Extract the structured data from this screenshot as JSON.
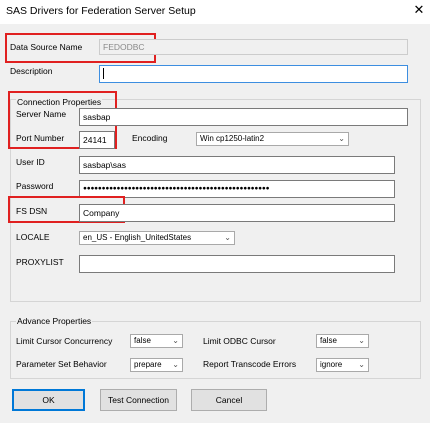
{
  "window": {
    "title": "SAS Drivers for Federation Server Setup",
    "close_glyph": "✕"
  },
  "datasource": {
    "label": "Data Source Name",
    "value": "FEDODBC"
  },
  "description": {
    "label": "Description",
    "value": ""
  },
  "connection": {
    "group_label": "Connection Properties",
    "server_name": {
      "label": "Server Name",
      "value": "sasbap"
    },
    "port_number": {
      "label": "Port Number",
      "value": "24141"
    },
    "encoding": {
      "label": "Encoding",
      "value": "Win cp1250-latin2"
    },
    "user_id": {
      "label": "User ID",
      "value": "sasbap\\sas"
    },
    "password": {
      "label": "Password",
      "value": "●●●●●●●●●●●●●●●●●●●●●●●●●●●●●●●●●●●●●●●●●●●●●●●●●●"
    },
    "fs_dsn": {
      "label": "FS DSN",
      "value": "Company"
    },
    "locale": {
      "label": "LOCALE",
      "value": "en_US - English_UnitedStates"
    },
    "proxylist": {
      "label": "PROXYLIST",
      "value": ""
    }
  },
  "advance": {
    "group_label": "Advance Properties",
    "limit_cursor_concurrency": {
      "label": "Limit Cursor Concurrency",
      "value": "false"
    },
    "limit_odbc_cursor": {
      "label": "Limit ODBC Cursor",
      "value": "false"
    },
    "parameter_set_behavior": {
      "label": "Parameter Set Behavior",
      "value": "prepare"
    },
    "report_transcode_errors": {
      "label": "Report Transcode Errors",
      "value": "ignore"
    }
  },
  "buttons": {
    "ok": "OK",
    "test_connection": "Test Connection",
    "cancel": "Cancel"
  },
  "dropdown_glyph": "⌄",
  "colors": {
    "highlight": "#e02020",
    "focus": "#3d8ee0",
    "dialog_bg": "#f0f0f0"
  }
}
